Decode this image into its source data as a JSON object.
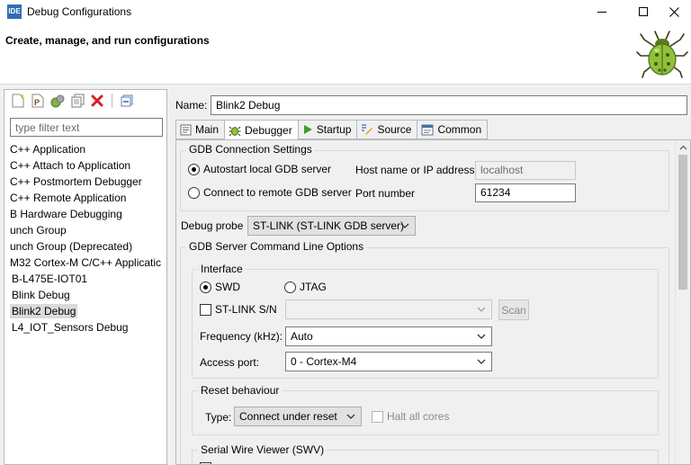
{
  "window": {
    "title": "Debug Configurations",
    "app_icon_text": "IDE"
  },
  "header": {
    "title": "Create, manage, and run configurations"
  },
  "left": {
    "filter_placeholder": "type filter text",
    "items": [
      "C++ Application",
      "C++ Attach to Application",
      "C++ Postmortem Debugger",
      "C++ Remote Application",
      "B Hardware Debugging",
      "unch Group",
      "unch Group (Deprecated)",
      "M32 Cortex-M C/C++ Applicatic",
      "B-L475E-IOT01",
      "Blink Debug",
      "Blink2 Debug",
      "L4_IOT_Sensors Debug"
    ],
    "selected_index": 10
  },
  "config": {
    "name_label": "Name:",
    "name_value": "Blink2 Debug",
    "tabs": [
      "Main",
      "Debugger",
      "Startup",
      "Source",
      "Common"
    ],
    "active_tab": "Debugger"
  },
  "gdb_connection": {
    "legend": "GDB Connection Settings",
    "autostart_label": "Autostart local GDB server",
    "remote_label": "Connect to remote GDB server",
    "host_label": "Host name or IP address",
    "host_value": "localhost",
    "port_label": "Port number",
    "port_value": "61234"
  },
  "probe": {
    "label": "Debug probe",
    "value": "ST-LINK (ST-LINK GDB server)"
  },
  "server_options": {
    "legend": "GDB Server Command Line Options",
    "interface": {
      "legend": "Interface",
      "swd_label": "SWD",
      "jtag_label": "JTAG",
      "stlink_sn_label": "ST-LINK S/N",
      "scan_label": "Scan",
      "frequency_label": "Frequency (kHz):",
      "frequency_value": "Auto",
      "access_port_label": "Access port:",
      "access_port_value": "0 - Cortex-M4"
    },
    "reset": {
      "legend": "Reset behaviour",
      "type_label": "Type:",
      "type_value": "Connect under reset",
      "halt_label": "Halt all cores"
    },
    "swv": {
      "legend": "Serial Wire Viewer (SWV)"
    }
  }
}
